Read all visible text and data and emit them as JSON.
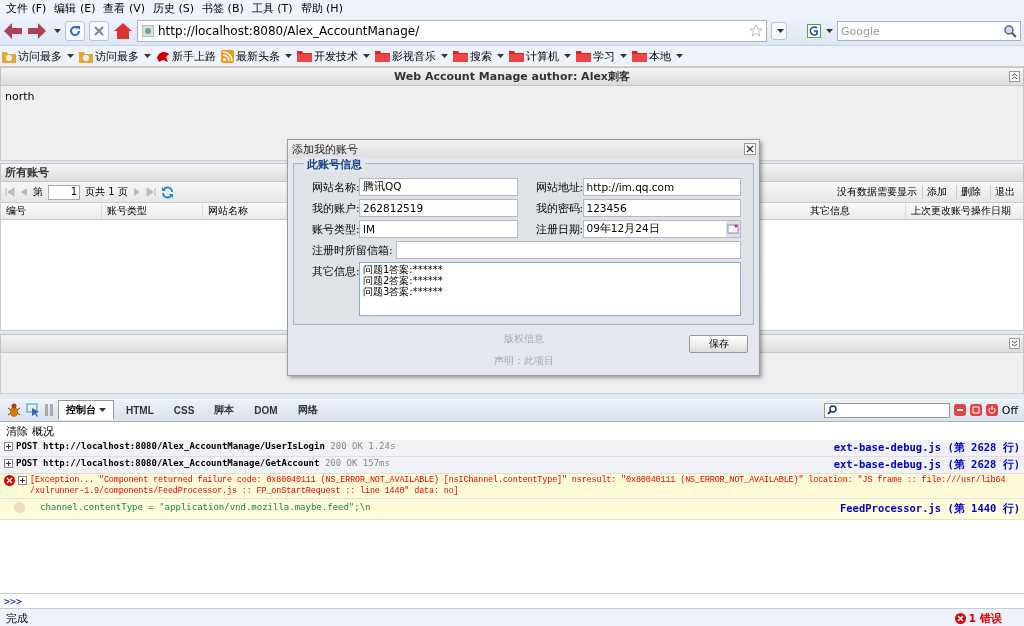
{
  "menu_bar": [
    "文件 (F)",
    "编辑 (E)",
    "查看 (V)",
    "历史 (S)",
    "书签 (B)",
    "工具 (T)",
    "帮助 (H)"
  ],
  "nav": {
    "url": "http://localhost:8080/Alex_AccountManage/",
    "search_placeholder": "Google"
  },
  "bookmarks": [
    {
      "label": "访问最多",
      "kind": "smart",
      "dropdown": true
    },
    {
      "label": "访问最多",
      "kind": "smart",
      "dropdown": true
    },
    {
      "label": "新手上路",
      "kind": "start",
      "dropdown": false
    },
    {
      "label": "最新头条",
      "kind": "feed",
      "dropdown": true
    },
    {
      "label": "开发技术",
      "kind": "folder",
      "dropdown": true
    },
    {
      "label": "影视音乐",
      "kind": "folder",
      "dropdown": true
    },
    {
      "label": "搜索",
      "kind": "folder",
      "dropdown": true
    },
    {
      "label": "计算机",
      "kind": "folder",
      "dropdown": true
    },
    {
      "label": "学习",
      "kind": "folder",
      "dropdown": true
    },
    {
      "label": "本地",
      "kind": "folder",
      "dropdown": true
    }
  ],
  "app": {
    "title": "Web Account Manage author: Alex刺客",
    "north_body": "north",
    "center": {
      "title": "所有账号",
      "pager": {
        "before": "第",
        "page": "1",
        "after": "页共 1 页"
      },
      "status": "没有数据需要显示",
      "actions": [
        "添加",
        "删除",
        "退出"
      ],
      "columns": [
        "编号",
        "账号类型",
        "网站名称",
        "其它信息",
        "上次更改账号操作日期"
      ]
    }
  },
  "dialog": {
    "title": "添加我的账号",
    "fieldset": "此账号信息",
    "fields": [
      {
        "label": "网站名称:",
        "value": "腾讯QQ",
        "kind": "text"
      },
      {
        "label": "网站地址:",
        "value": "http://im.qq.com",
        "kind": "text"
      },
      {
        "label": "我的账户:",
        "value": "262812519",
        "kind": "text"
      },
      {
        "label": "我的密码:",
        "value": "123456",
        "kind": "text"
      },
      {
        "label": "账号类型:",
        "value": "IM",
        "kind": "text"
      },
      {
        "label": "注册日期:",
        "value": "09年12月24日",
        "kind": "date"
      },
      {
        "label": "注册时所留信箱:",
        "kind": "wide"
      },
      {
        "label": "其它信息:",
        "lines": [
          "问题1答案:******",
          "问题2答案:******",
          "问题3答案:******"
        ],
        "kind": "textarea"
      }
    ],
    "button": "保存",
    "behind_texts": [
      "版权信息",
      "声明：此项目"
    ]
  },
  "firebug": {
    "tabs": [
      {
        "label": "控制台",
        "selected": true
      },
      {
        "label": "HTML",
        "selected": false
      },
      {
        "label": "CSS",
        "selected": false
      },
      {
        "label": "脚本",
        "selected": false
      },
      {
        "label": "DOM",
        "selected": false
      },
      {
        "label": "网络",
        "selected": false
      }
    ],
    "off": "Off",
    "subbar": [
      "清除",
      "概况"
    ],
    "log": [
      {
        "kind": "request",
        "method": "POST",
        "url": "http://localhost:8080/Alex_AccountManage/UserIsLogin",
        "status": "200 OK",
        "time": "1.24s",
        "source": "ext-base-debug.js (第 2628 行)"
      },
      {
        "kind": "request",
        "method": "POST",
        "url": "http://localhost:8080/Alex_AccountManage/GetAccount",
        "status": "200 OK",
        "time": "157ms",
        "source": "ext-base-debug.js (第 2628 行)"
      },
      {
        "kind": "error",
        "lines": [
          "[Exception... \"Component returned failure code: 0x80040111 (NS_ERROR_NOT_AVAILABLE) [nsIChannel.contentType]\" nsresult: \"0x80040111 (NS_ERROR_NOT_AVAILABLE)\" location: \"JS frame :: file:///usr/lib64",
          "/xulrunner-1.9/components/FeedProcessor.js :: FP_onStartRequest :: line 1440\" data: no]"
        ]
      },
      {
        "kind": "info",
        "message": "channel.contentType = \"application/vnd.mozilla.maybe.feed\";\\n",
        "source": "FeedProcessor.js (第 1440 行)"
      }
    ],
    "prompt": ">>>"
  },
  "status_bar": {
    "text": "完成",
    "errors": "1 错误"
  }
}
